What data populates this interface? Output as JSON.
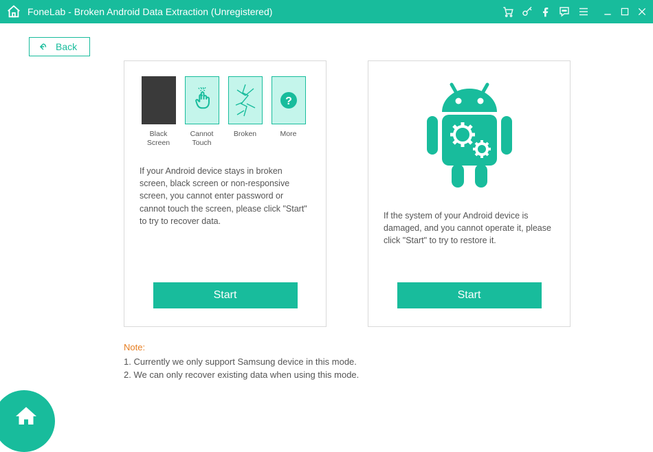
{
  "titlebar": {
    "title": "FoneLab - Broken Android Data Extraction (Unregistered)"
  },
  "back": {
    "label": "Back"
  },
  "card_left": {
    "tiles": [
      {
        "label": "Black Screen"
      },
      {
        "label": "Cannot Touch"
      },
      {
        "label": "Broken"
      },
      {
        "label": "More"
      }
    ],
    "desc": "If your Android device stays in broken screen, black screen or non-responsive screen, you cannot enter password or cannot touch the screen, please click \"Start\" to try to recover data.",
    "start": "Start"
  },
  "card_right": {
    "desc": "If the system of your Android device is damaged, and you cannot operate it, please click \"Start\" to try to restore it.",
    "start": "Start"
  },
  "note": {
    "label": "Note:",
    "line1": "1. Currently we only support Samsung device in this mode.",
    "line2": "2. We can only recover existing data when using this mode."
  }
}
